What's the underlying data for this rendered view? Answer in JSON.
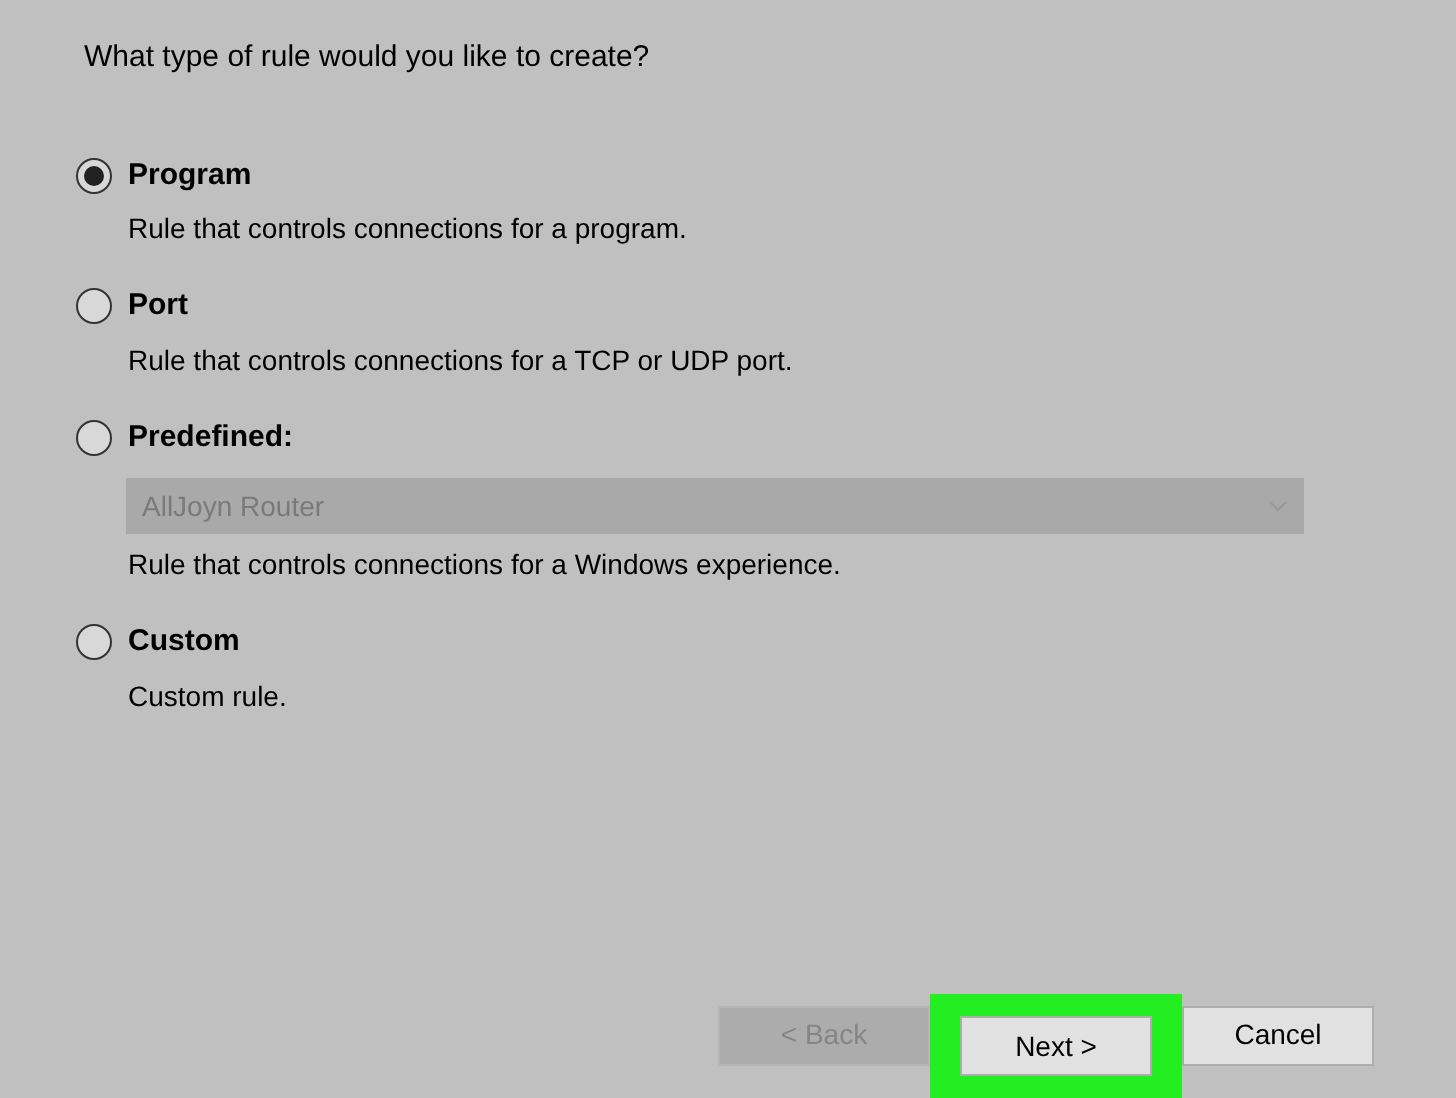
{
  "question": "What type of rule would you like to create?",
  "options": [
    {
      "label": "Program",
      "selected": true,
      "description": "Rule that controls connections for a program."
    },
    {
      "label": "Port",
      "selected": false,
      "description": "Rule that controls connections for a TCP or UDP port."
    },
    {
      "label": "Predefined:",
      "selected": false,
      "dropdown": {
        "value": "AllJoyn Router",
        "disabled": true
      },
      "description": "Rule that controls connections for a Windows experience."
    },
    {
      "label": "Custom",
      "selected": false,
      "description": "Custom rule."
    }
  ],
  "buttons": [
    {
      "label": "< Back",
      "disabled": true,
      "highlighted": false
    },
    {
      "label": "Next >",
      "disabled": false,
      "highlighted": true
    },
    {
      "label": "Cancel",
      "disabled": false,
      "highlighted": false
    }
  ]
}
